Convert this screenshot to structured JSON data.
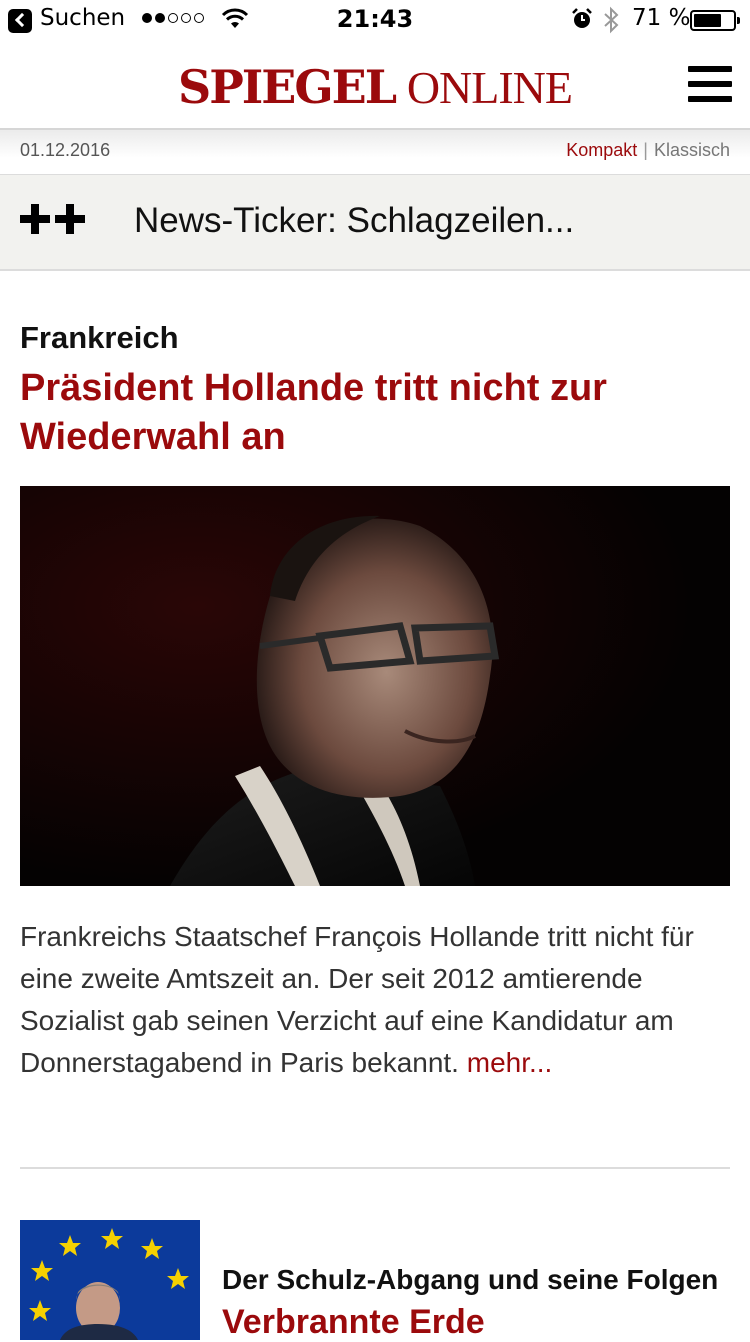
{
  "status_bar": {
    "back_label": "Suchen",
    "time": "21:43",
    "battery_percent": "71 %",
    "battery_level": 0.71,
    "signal_bars_filled": 2,
    "signal_bars_total": 5
  },
  "header": {
    "logo_part1": "SPIEGEL",
    "logo_part2": "ONLINE",
    "brand_color": "#9b0a0c"
  },
  "datebar": {
    "date": "01.12.2016",
    "view_kompakt": "Kompakt",
    "view_separator": "|",
    "view_klassisch": "Klassisch"
  },
  "ticker": {
    "icon": "plus-plus-icon",
    "label": "News-Ticker: Schlagzeilen..."
  },
  "lead_article": {
    "kicker": "Frankreich",
    "headline": "Präsident Hollande tritt nicht zur Wiederwahl an",
    "teaser": "Frankreichs Staatschef François Hollande tritt nicht für eine zweite Amtszeit an. Der seit 2012 amtierende Sozialist gab seinen Verzicht auf eine Kandidatur am Donnerstagabend in Paris bekannt.",
    "more_link": "mehr..."
  },
  "second_article": {
    "kicker": "Der Schulz-Abgang und seine Folgen",
    "headline": "Verbrannte Erde"
  }
}
